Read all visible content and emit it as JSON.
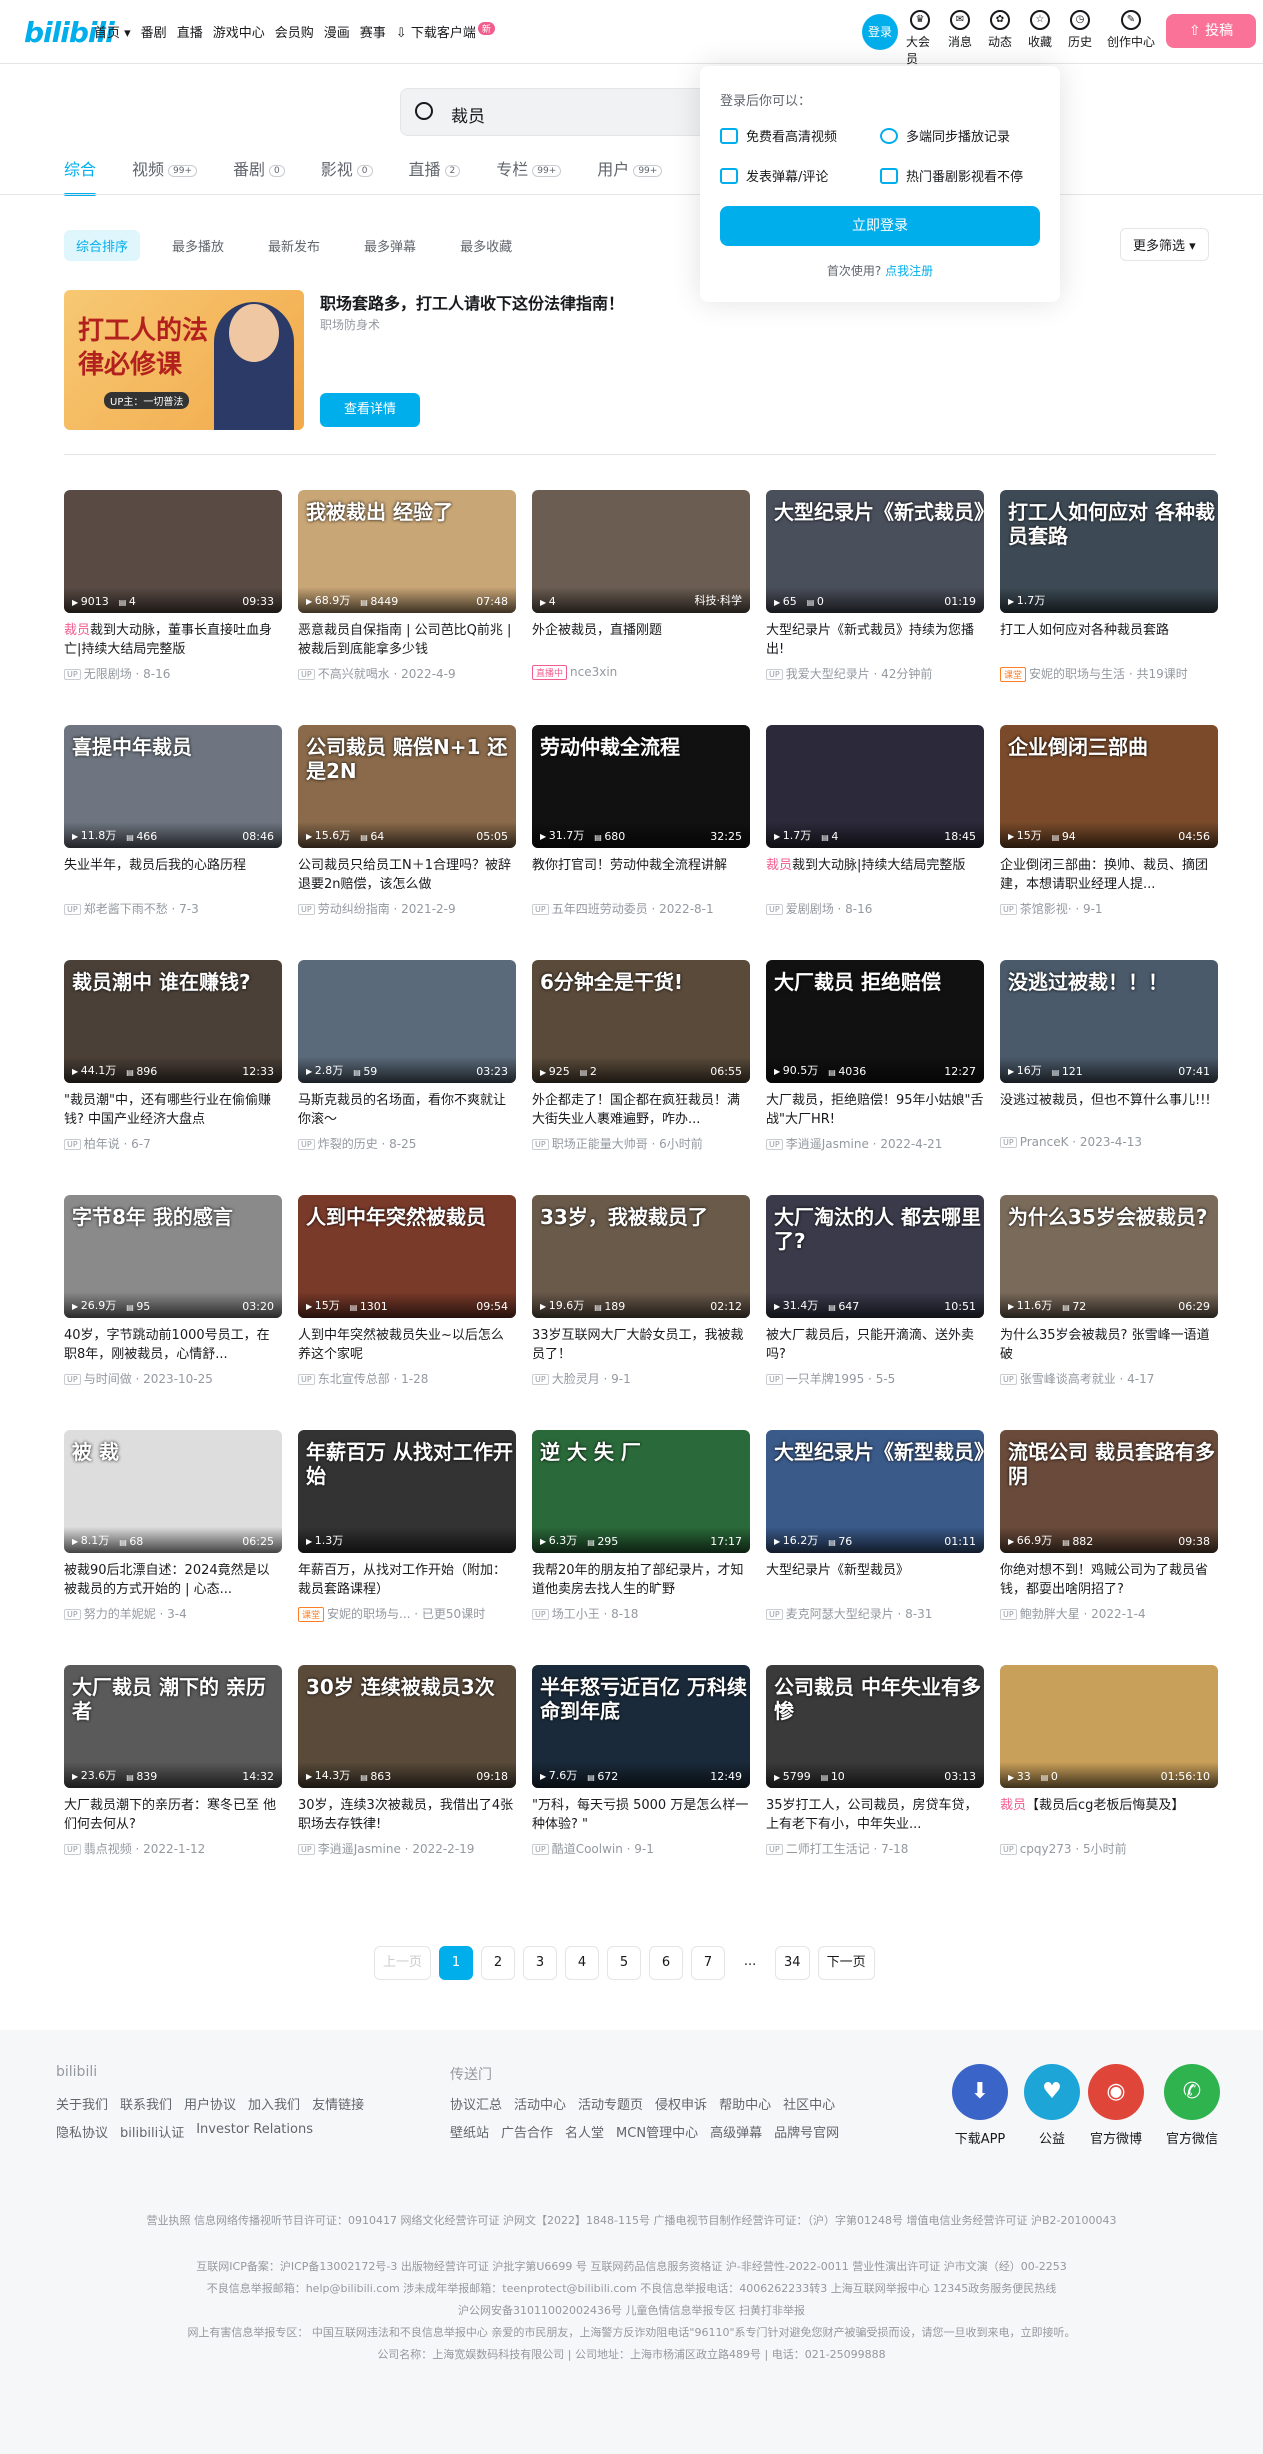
{
  "header": {
    "logo": "bilibili",
    "nav": [
      {
        "label": "首页 ▾"
      },
      {
        "label": "番剧"
      },
      {
        "label": "直播"
      },
      {
        "label": "游戏中心"
      },
      {
        "label": "会员购"
      },
      {
        "label": "漫画"
      },
      {
        "label": "赛事"
      },
      {
        "label": "下载客户端"
      }
    ],
    "nav_badge": "新",
    "login": "登录",
    "right_icons": [
      {
        "label": "大会员",
        "icon": "vip-icon"
      },
      {
        "label": "消息",
        "icon": "message-icon"
      },
      {
        "label": "动态",
        "icon": "dynamic-icon"
      },
      {
        "label": "收藏",
        "icon": "favorite-icon"
      },
      {
        "label": "历史",
        "icon": "history-icon"
      },
      {
        "label": "创作中心",
        "icon": "creator-icon"
      }
    ],
    "upload": "投稿"
  },
  "search": {
    "value": "裁员"
  },
  "tabs": [
    {
      "label": "综合",
      "count": ""
    },
    {
      "label": "视频",
      "count": "99+"
    },
    {
      "label": "番剧",
      "count": "0"
    },
    {
      "label": "影视",
      "count": "0"
    },
    {
      "label": "直播",
      "count": "2"
    },
    {
      "label": "专栏",
      "count": "99+"
    },
    {
      "label": "用户",
      "count": "99+"
    }
  ],
  "sort": [
    "综合排序",
    "最多播放",
    "最新发布",
    "最多弹幕",
    "最多收藏"
  ],
  "more_filter": "更多筛选 ▾",
  "ad": {
    "image_text": "打工人的法律必修课",
    "image_sub": "UP主：一切普法",
    "title": "职场套路多，打工人请收下这份法律指南！",
    "sub": "职场防身术",
    "button": "查看详情"
  },
  "videos": [
    {
      "thumb": "",
      "bg": "#5a4a44",
      "plays": "9013",
      "danmaku": "4",
      "dur": "09:33",
      "title_hl": "裁员",
      "title": "裁到大动脉，董事长直接吐血身亡|持续大结局完整版",
      "author": "无限剧场",
      "date": "8-16"
    },
    {
      "thumb": "我被裁出 经验了",
      "bg": "#c9a676",
      "plays": "68.9万",
      "danmaku": "8449",
      "dur": "07:48",
      "title_hl": "",
      "title": "恶意裁员自保指南 | 公司芭比Q前兆 | 被裁后到底能拿多少钱",
      "author": "不高兴就喝水",
      "date": "2022-4-9"
    },
    {
      "thumb": "",
      "bg": "#6b5d52",
      "plays": "4",
      "danmaku": "",
      "dur": "科技·科学",
      "title_hl": "",
      "title": "外企被裁员，直播刚题",
      "author": "nce3xin",
      "date": "",
      "tag": "直播中"
    },
    {
      "thumb": "大型纪录片《新式裁员》",
      "bg": "#4a4f5c",
      "plays": "65",
      "danmaku": "0",
      "dur": "01:19",
      "title_hl": "",
      "title": "大型纪录片《新式裁员》持续为您播出!",
      "author": "我爱大型纪录片",
      "date": "42分钟前"
    },
    {
      "thumb": "打工人如何应对 各种裁员套路",
      "bg": "#3d4a55",
      "plays": "1.7万",
      "danmaku": "",
      "dur": "",
      "title_hl": "",
      "title": "打工人如何应对各种裁员套路",
      "author": "安妮的职场与生活",
      "date": "共19课时",
      "tag": "课堂",
      "tagorange": true
    },
    {
      "thumb": "喜提中年裁员",
      "bg": "#6e7580",
      "plays": "11.8万",
      "danmaku": "466",
      "dur": "08:46",
      "title_hl": "",
      "title": "失业半年，裁员后我的心路历程",
      "author": "郑老酱下雨不愁",
      "date": "7-3"
    },
    {
      "thumb": "公司裁员 赔偿N+1 还是2N",
      "bg": "#8a6a4a",
      "plays": "15.6万",
      "danmaku": "64",
      "dur": "05:05",
      "title_hl": "",
      "title": "公司裁员只给员工N＋1合理吗？被辞退要2n赔偿，该怎么做",
      "author": "劳动纠纷指南",
      "date": "2021-2-9"
    },
    {
      "thumb": "劳动仲裁全流程",
      "bg": "#111",
      "plays": "31.7万",
      "danmaku": "680",
      "dur": "32:25",
      "title_hl": "",
      "title": "教你打官司！劳动仲裁全流程讲解",
      "author": "五年四班劳动委员",
      "date": "2022-8-1"
    },
    {
      "thumb": "",
      "bg": "#2c2a3a",
      "plays": "1.7万",
      "danmaku": "4",
      "dur": "18:45",
      "title_hl": "裁员",
      "title": "裁到大动脉|持续大结局完整版",
      "author": "爱剧剧场",
      "date": "8-16"
    },
    {
      "thumb": "企业倒闭三部曲",
      "bg": "#7a4a2a",
      "plays": "15万",
      "danmaku": "94",
      "dur": "04:56",
      "title_hl": "",
      "title": "企业倒闭三部曲：换帅、裁员、摘团建，本想请职业经理人提...",
      "author": "茶馆影视·",
      "date": "9-1"
    },
    {
      "thumb": "裁员潮中 谁在赚钱?",
      "bg": "#4a4038",
      "plays": "44.1万",
      "danmaku": "896",
      "dur": "12:33",
      "title_hl": "",
      "title": "\"裁员潮\"中，还有哪些行业在偷偷赚钱? 中国产业经济大盘点",
      "author": "柏年说",
      "date": "6-7"
    },
    {
      "thumb": "",
      "bg": "#5a6a7a",
      "plays": "2.8万",
      "danmaku": "59",
      "dur": "03:23",
      "title_hl": "",
      "title": "马斯克裁员的名场面，看你不爽就让你滚～",
      "author": "炸裂的历史",
      "date": "8-25"
    },
    {
      "thumb": "6分钟全是干货!",
      "bg": "#5a4a3a",
      "plays": "925",
      "danmaku": "2",
      "dur": "06:55",
      "title_hl": "",
      "title": "外企都走了！国企都在疯狂裁员！满大街失业人裹难遍野，咋办...",
      "author": "职场正能量大帅哥",
      "date": "6小时前"
    },
    {
      "thumb": "大厂裁员 拒绝赔偿",
      "bg": "#111",
      "plays": "90.5万",
      "danmaku": "4036",
      "dur": "12:27",
      "title_hl": "",
      "title": "大厂裁员，拒绝赔偿！95年小姑娘\"舌战\"大厂HR!",
      "author": "李逍遥Jasmine",
      "date": "2022-4-21"
    },
    {
      "thumb": "没逃过被裁！！！",
      "bg": "#4a5a6a",
      "plays": "16万",
      "danmaku": "121",
      "dur": "07:41",
      "title_hl": "",
      "title": "没逃过被裁员，但也不算什么事儿!!!",
      "author": "PranceK",
      "date": "2023-4-13"
    },
    {
      "thumb": "字节8年 我的感言",
      "bg": "#8a8a8a",
      "plays": "26.9万",
      "danmaku": "95",
      "dur": "03:20",
      "title_hl": "",
      "title": "40岁，字节跳动前1000号员工，在职8年，刚被裁员，心情舒...",
      "author": "与时间做",
      "date": "2023-10-25"
    },
    {
      "thumb": "人到中年突然被裁员",
      "bg": "#7a3a2a",
      "plays": "15万",
      "danmaku": "1301",
      "dur": "09:54",
      "title_hl": "",
      "title": "人到中年突然被裁员失业~以后怎么养这个家呢",
      "author": "东北宣传总部",
      "date": "1-28"
    },
    {
      "thumb": "33岁，我被裁员了",
      "bg": "#6a5a4a",
      "plays": "19.6万",
      "danmaku": "189",
      "dur": "02:12",
      "title_hl": "",
      "title": "33岁互联网大厂大龄女员工，我被裁员了！",
      "author": "大脸灵月",
      "date": "9-1"
    },
    {
      "thumb": "大厂淘汰的人 都去哪里了?",
      "bg": "#3a3a4a",
      "plays": "31.4万",
      "danmaku": "647",
      "dur": "10:51",
      "title_hl": "",
      "title": "被大厂裁员后，只能开滴滴、送外卖吗?",
      "author": "一只羊牌1995",
      "date": "5-5"
    },
    {
      "thumb": "为什么35岁会被裁员?",
      "bg": "#7a6a5a",
      "plays": "11.6万",
      "danmaku": "72",
      "dur": "06:29",
      "title_hl": "",
      "title": "为什么35岁会被裁员? 张雪峰一语道破",
      "author": "张雪峰谈高考就业",
      "date": "4-17"
    },
    {
      "thumb": "被 裁",
      "bg": "#ddd",
      "plays": "8.1万",
      "danmaku": "68",
      "dur": "06:25",
      "title_hl": "",
      "title": "被裁90后北漂自述：2024竟然是以被裁员的方式开始的 | 心态...",
      "author": "努力的羊妮妮",
      "date": "3-4"
    },
    {
      "thumb": "年薪百万 从找对工作开始",
      "bg": "#333",
      "plays": "1.3万",
      "danmaku": "",
      "dur": "",
      "title_hl": "",
      "title": "年薪百万，从找对工作开始（附加：裁员套路课程）",
      "author": "安妮的职场与...",
      "date": "已更50课时",
      "tag": "课堂",
      "tagorange": true
    },
    {
      "thumb": "逆 大 失 厂",
      "bg": "#2a6a3a",
      "plays": "6.3万",
      "danmaku": "295",
      "dur": "17:17",
      "title_hl": "",
      "title": "我帮20年的朋友拍了部纪录片，才知道他卖房去找人生的旷野",
      "author": "场工小王",
      "date": "8-18"
    },
    {
      "thumb": "大型纪录片《新型裁员》",
      "bg": "#3a5a8a",
      "plays": "16.2万",
      "danmaku": "76",
      "dur": "01:11",
      "title_hl": "",
      "title": "大型纪录片《新型裁员》",
      "author": "麦克阿瑟大型纪录片",
      "date": "8-31"
    },
    {
      "thumb": "流氓公司 裁员套路有多阴",
      "bg": "#6a4a3a",
      "plays": "66.9万",
      "danmaku": "882",
      "dur": "09:38",
      "title_hl": "",
      "title": "你绝对想不到！鸡贼公司为了裁员省钱，都耍出啥阴招了?",
      "author": "鲍勃胖大星",
      "date": "2022-1-4"
    },
    {
      "thumb": "大厂裁员 潮下的 亲历者",
      "bg": "#5a5a5a",
      "plays": "23.6万",
      "danmaku": "839",
      "dur": "14:32",
      "title_hl": "",
      "title": "大厂裁员潮下的亲历者：寒冬已至 他们何去何从?",
      "author": "翡点视频",
      "date": "2022-1-12"
    },
    {
      "thumb": "30岁 连续被裁员3次",
      "bg": "#5a4a3a",
      "plays": "14.3万",
      "danmaku": "863",
      "dur": "09:18",
      "title_hl": "",
      "title": "30岁，连续3次被裁员，我借出了4张职场去存铁律!",
      "author": "李逍遥Jasmine",
      "date": "2022-2-19"
    },
    {
      "thumb": "半年怒亏近百亿 万科续命到年底",
      "bg": "#1a2a3a",
      "plays": "7.6万",
      "danmaku": "672",
      "dur": "12:49",
      "title_hl": "",
      "title": "\"万科，每天亏损 5000 万是怎么样一种体验? \"",
      "author": "酷道Coolwin",
      "date": "9-1"
    },
    {
      "thumb": "公司裁员 中年失业有多惨",
      "bg": "#3a3a3a",
      "plays": "5799",
      "danmaku": "10",
      "dur": "03:13",
      "title_hl": "",
      "title": "35岁打工人，公司裁员，房贷车贷，上有老下有小，中年失业...",
      "author": "二师打工生活记",
      "date": "7-18"
    },
    {
      "thumb": "",
      "bg": "#c9a05a",
      "plays": "33",
      "danmaku": "0",
      "dur": "01:56:10",
      "title_hl": "裁员",
      "title": "【裁员后cg老板后悔莫及】",
      "author": "cpqy273",
      "date": "5小时前"
    }
  ],
  "pager": [
    "上一页",
    "1",
    "2",
    "3",
    "4",
    "5",
    "6",
    "7",
    "...",
    "34",
    "下一页"
  ],
  "popover": {
    "heading": "登录后你可以：",
    "items": [
      "免费看高清视频",
      "多端同步播放记录",
      "发表弹幕/评论",
      "热门番剧影视看不停"
    ],
    "button": "立即登录",
    "first_use": "首次使用? ",
    "register": "点我注册"
  },
  "footer": {
    "col1_title": "bilibili",
    "col1_row1": [
      "关于我们",
      "联系我们",
      "用户协议",
      "加入我们",
      "友情链接"
    ],
    "col1_row2": [
      "隐私协议",
      "bilibili认证",
      "Investor Relations"
    ],
    "col2_title": "传送门",
    "col2_row1": [
      "协议汇总",
      "活动中心",
      "活动专题页",
      "侵权申诉",
      "帮助中心",
      "社区中心"
    ],
    "col2_row2": [
      "壁纸站",
      "广告合作",
      "名人堂",
      "MCN管理中心",
      "高级弹幕",
      "品牌号官网"
    ],
    "apps": [
      {
        "label": "下载APP",
        "color": "#3b64c8"
      },
      {
        "label": "公益",
        "color": "#1ea5d8"
      },
      {
        "label": "官方微博",
        "color": "#e0453a"
      },
      {
        "label": "官方微信",
        "color": "#2fb34f"
      }
    ],
    "legal": [
      "营业执照  信息网络传播视听节目许可证：0910417  网络文化经营许可证 沪网文【2022】1848-115号  广播电视节目制作经营许可证：（沪）字第01248号  增值电信业务经营许可证 沪B2-20100043",
      "互联网ICP备案：沪ICP备13002172号-3  出版物经营许可证 沪批字第U6699 号  互联网药品信息服务资格证 沪-非经营性-2022-0011  营业性演出许可证 沪市文演（经）00-2253",
      "不良信息举报邮箱：help@bilibili.com  涉未成年举报邮箱：teenprotect@bilibili.com  不良信息举报电话：4006262233转3  上海互联网举报中心  12345政务服务便民热线",
      "沪公网安备31011002002436号  儿童色情信息举报专区  扫黄打非举报",
      "网上有害信息举报专区：  中国互联网违法和不良信息举报中心  亲爱的市民朋友，上海警方反诈劝阻电话\"96110\"系专门针对避免您财产被骗受损而设，请您一旦收到来电，立即接听。",
      "公司名称：上海宽娱数码科技有限公司 | 公司地址：上海市杨浦区政立路489号 | 电话：021-25099888"
    ]
  }
}
